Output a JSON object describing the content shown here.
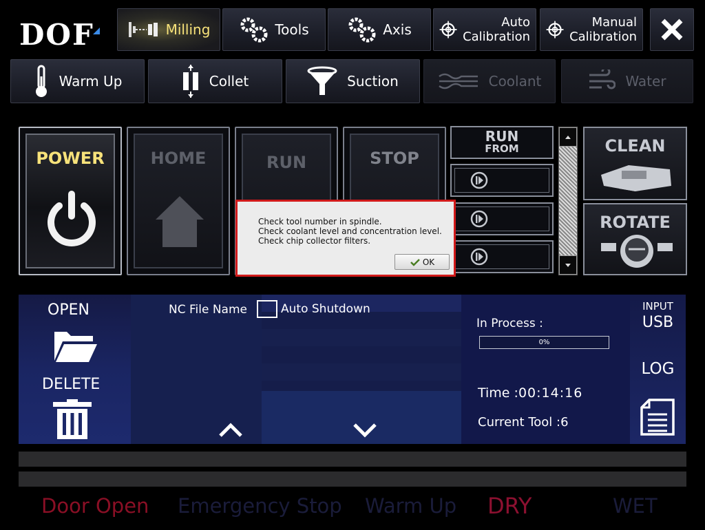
{
  "logo": "DOF",
  "topbar": {
    "milling": "Milling",
    "tools": "Tools",
    "axis": "Axis",
    "auto_cal_1": "Auto",
    "auto_cal_2": "Calibration",
    "manual_cal_1": "Manual",
    "manual_cal_2": "Calibration"
  },
  "secondrow": {
    "warmup": "Warm Up",
    "collet": "Collet",
    "suction": "Suction",
    "coolant": "Coolant",
    "water": "Water"
  },
  "controls": {
    "power": "POWER",
    "home": "HOME",
    "run": "RUN",
    "stop": "STOP",
    "run_from_1": "RUN",
    "run_from_2": "FROM",
    "clean": "CLEAN",
    "rotate": "ROTATE"
  },
  "file_panel": {
    "open": "OPEN",
    "delete": "DELETE",
    "nc_file_name": "NC File Name",
    "auto_shutdown": "Auto Shutdown"
  },
  "process": {
    "in_process_label": "In Process :",
    "progress_percent": "0%",
    "progress_value": 0,
    "time_label": "Time :",
    "time_value": "00:14:16",
    "tool_label": "Current Tool :",
    "tool_value": "6"
  },
  "right_panel": {
    "input": "INPUT",
    "usb": "USB",
    "log": "LOG"
  },
  "status_bar": {
    "door_open": "Door Open",
    "emergency_stop": "Emergency Stop",
    "warm_up": "Warm Up",
    "dry": "DRY",
    "wet": "WET"
  },
  "dialog": {
    "line1": "Check tool number in spindle.",
    "line2": "Check coolant level and concentration level.",
    "line3": "Check chip collector filters.",
    "ok": "OK"
  },
  "colors": {
    "accent_yellow": "#f7e27a",
    "navy": "#16204f",
    "dialog_border": "#d11a1a",
    "door_open": "#8a0f25",
    "dry": "#8c1030",
    "dim_text": "#1a1c3a"
  }
}
